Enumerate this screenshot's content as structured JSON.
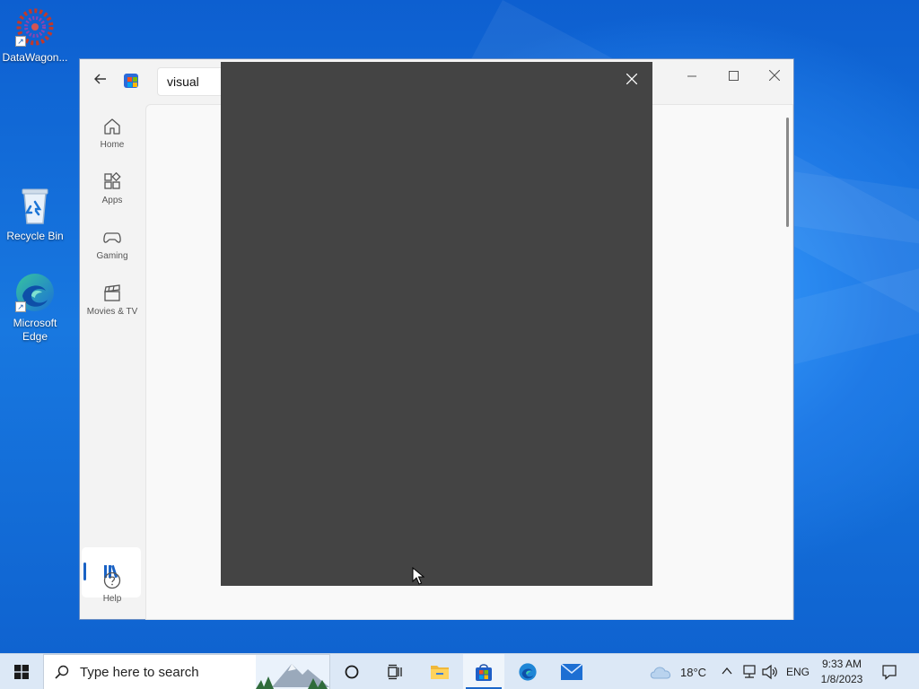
{
  "desktop": {
    "icons": [
      {
        "label": "DataWagon...",
        "icon": "datawagon-icon"
      },
      {
        "label": "Recycle Bin",
        "icon": "recycle-bin-icon"
      },
      {
        "label": "Microsoft Edge",
        "icon": "edge-icon"
      }
    ]
  },
  "store": {
    "search_value": "visual",
    "nav": [
      {
        "label": "Home",
        "icon": "home-icon"
      },
      {
        "label": "Apps",
        "icon": "apps-icon"
      },
      {
        "label": "Gaming",
        "icon": "gamepad-icon"
      },
      {
        "label": "Movies & TV",
        "icon": "clapperboard-icon"
      }
    ],
    "library_icon": "library-icon",
    "help_label": "Help",
    "accent": "#1a62c4"
  },
  "overlay": {
    "background": "#444444"
  },
  "taskbar": {
    "search_placeholder": "Type here to search",
    "weather_temp": "18°C",
    "language": "ENG",
    "time": "9:33 AM",
    "date": "1/8/2023"
  }
}
